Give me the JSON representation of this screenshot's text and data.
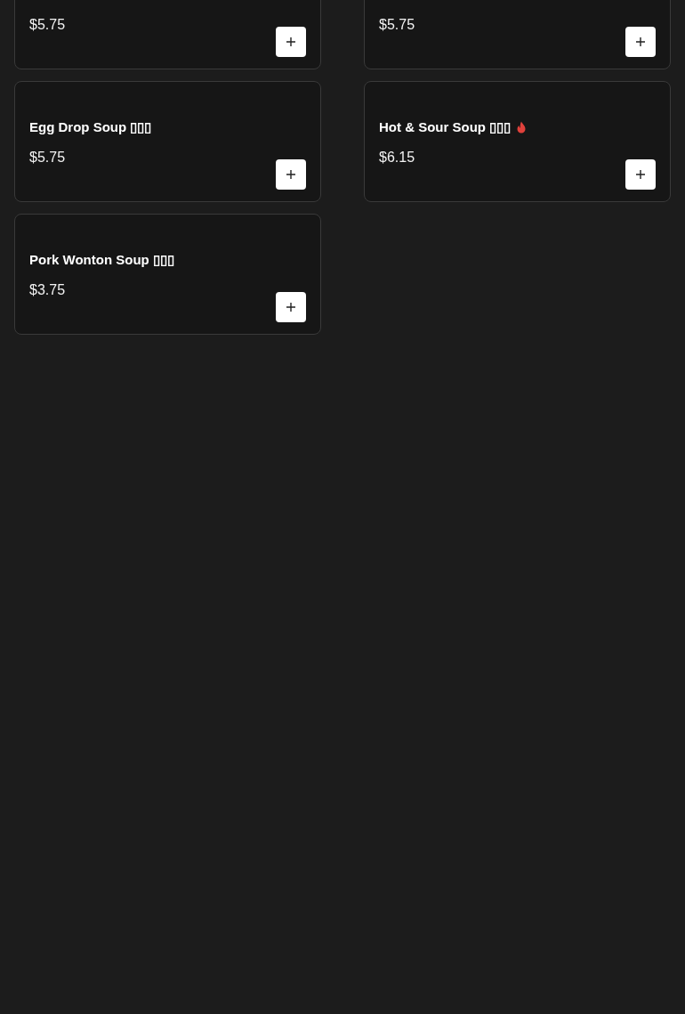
{
  "menu_items": [
    {
      "price": "$5.75",
      "spicy": false
    },
    {
      "price": "$5.75",
      "spicy": false
    },
    {
      "name": "Egg Drop Soup ▯▯▯",
      "price": "$5.75",
      "spicy": false
    },
    {
      "name": "Hot & Sour Soup ▯▯▯",
      "price": "$6.15",
      "spicy": true
    },
    {
      "name": "Pork Wonton Soup ▯▯▯",
      "price": "$3.75",
      "spicy": false
    }
  ]
}
